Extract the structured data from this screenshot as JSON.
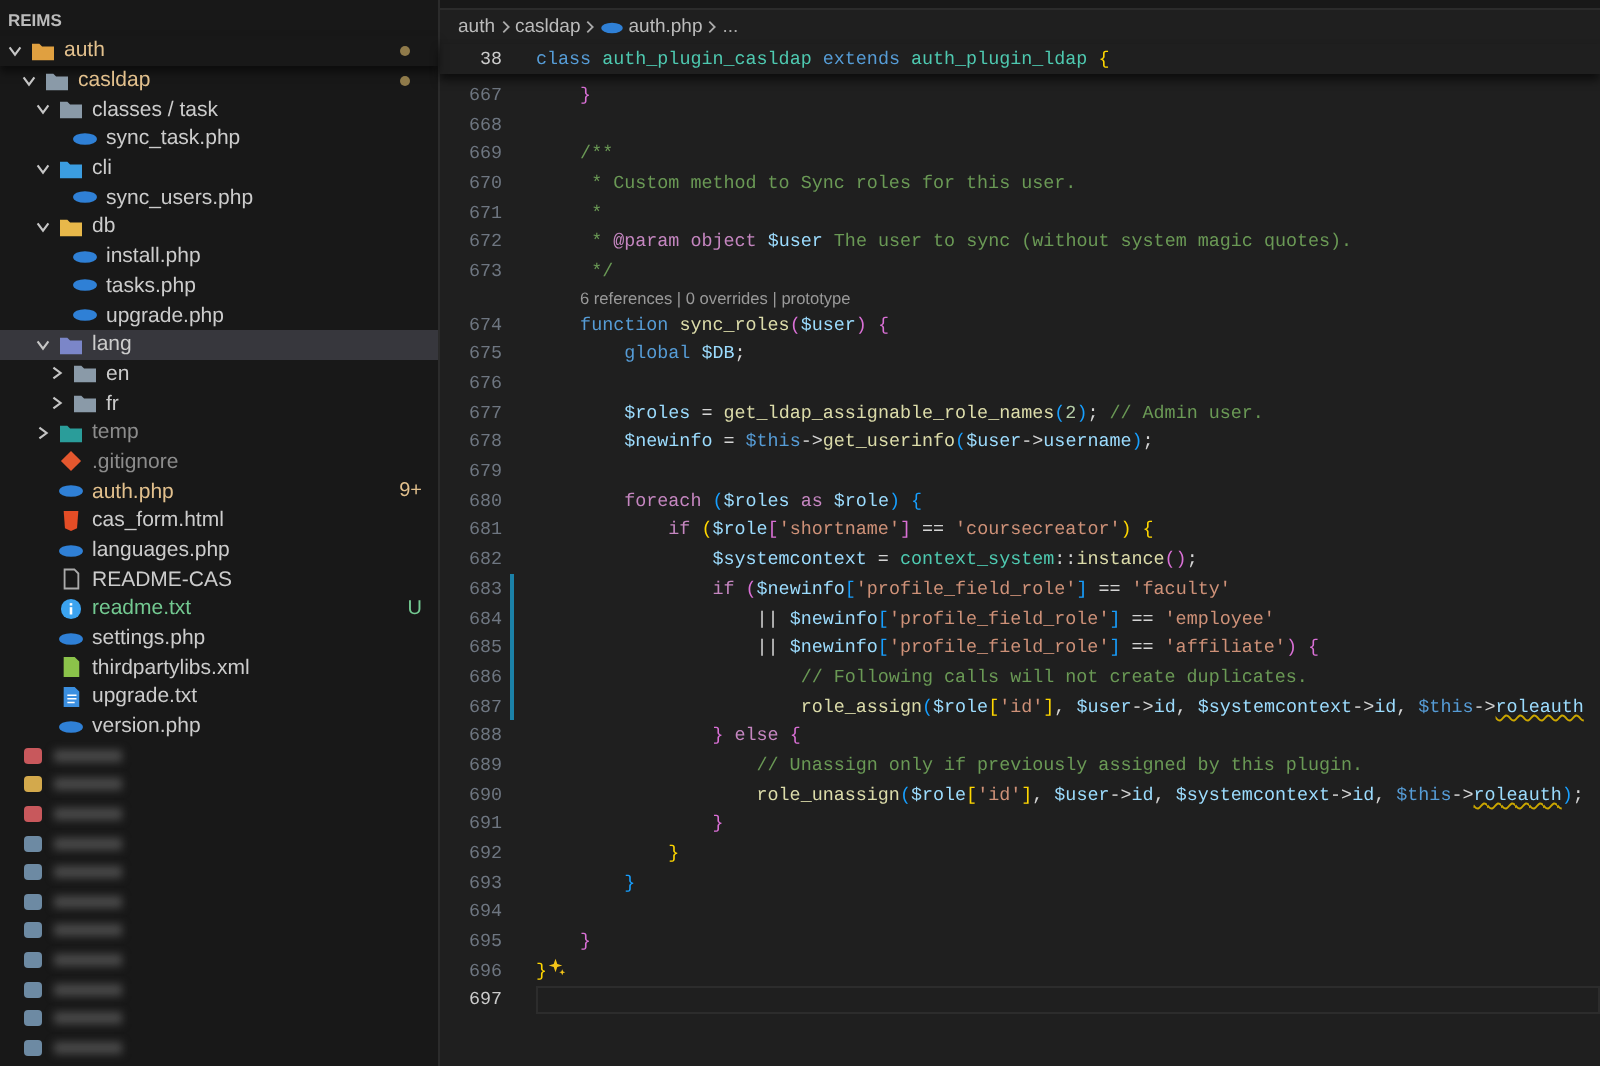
{
  "explorer": {
    "title": "REIMS",
    "items": [
      {
        "label": "auth",
        "kind": "srcfolder",
        "expanded": true,
        "selected": false,
        "color": "#e2c08d",
        "dot": true,
        "children": [
          {
            "label": "casldap",
            "kind": "folder",
            "expanded": true,
            "selected": false,
            "color": "#e2c08d",
            "dot": true,
            "children": [
              {
                "label": "classes / task",
                "kind": "folder",
                "expanded": true,
                "selected": false,
                "children": [
                  {
                    "label": "sync_task.php",
                    "kind": "php",
                    "selected": false
                  }
                ]
              },
              {
                "label": "cli",
                "kind": "clifolder",
                "expanded": true,
                "selected": false,
                "children": [
                  {
                    "label": "sync_users.php",
                    "kind": "php",
                    "selected": false
                  }
                ]
              },
              {
                "label": "db",
                "kind": "dbfolder",
                "expanded": true,
                "selected": false,
                "children": [
                  {
                    "label": "install.php",
                    "kind": "php",
                    "selected": false
                  },
                  {
                    "label": "tasks.php",
                    "kind": "php",
                    "selected": false
                  },
                  {
                    "label": "upgrade.php",
                    "kind": "php",
                    "selected": false
                  }
                ]
              },
              {
                "label": "lang",
                "kind": "langfolder",
                "expanded": true,
                "selected": true,
                "children": [
                  {
                    "label": "en",
                    "kind": "folder",
                    "expanded": false,
                    "selected": false
                  },
                  {
                    "label": "fr",
                    "kind": "folder",
                    "expanded": false,
                    "selected": false
                  }
                ]
              },
              {
                "label": "temp",
                "kind": "tempfolder",
                "expanded": false,
                "selected": false,
                "color": "#8c8c8c"
              },
              {
                "label": ".gitignore",
                "kind": "git",
                "selected": false,
                "color": "#8c8c8c"
              },
              {
                "label": "auth.php",
                "kind": "php",
                "selected": false,
                "color": "#e2c08d",
                "badge": "9+"
              },
              {
                "label": "cas_form.html",
                "kind": "html",
                "selected": false
              },
              {
                "label": "languages.php",
                "kind": "php",
                "selected": false
              },
              {
                "label": "README-CAS",
                "kind": "plain",
                "selected": false
              },
              {
                "label": "readme.txt",
                "kind": "info",
                "selected": false,
                "color": "#73c991",
                "badge": "U"
              },
              {
                "label": "settings.php",
                "kind": "php",
                "selected": false
              },
              {
                "label": "thirdpartylibs.xml",
                "kind": "xml",
                "selected": false
              },
              {
                "label": "upgrade.txt",
                "kind": "txt",
                "selected": false
              },
              {
                "label": "version.php",
                "kind": "php",
                "selected": false
              }
            ]
          }
        ]
      }
    ],
    "blurred_items": [
      {
        "color": "#c8585c"
      },
      {
        "color": "#d3a94c"
      },
      {
        "color": "#c8585c"
      },
      {
        "color": "#6d8aa3"
      },
      {
        "color": "#6d8aa3"
      },
      {
        "color": "#6d8aa3"
      },
      {
        "color": "#6d8aa3"
      },
      {
        "color": "#6d8aa3"
      },
      {
        "color": "#6d8aa3"
      },
      {
        "color": "#6d8aa3"
      },
      {
        "color": "#6d8aa3"
      }
    ]
  },
  "editor": {
    "breadcrumbs": [
      {
        "label": "auth",
        "kind": "folder"
      },
      {
        "label": "casldap",
        "kind": "folder"
      },
      {
        "label": "auth.php",
        "kind": "php"
      },
      {
        "label": "...",
        "kind": "more"
      }
    ],
    "sticky_line": {
      "number": "38",
      "tokens": [
        {
          "kind": "kw",
          "text": "class "
        },
        {
          "kind": "cls",
          "text": "auth_plugin_casldap "
        },
        {
          "kind": "kw",
          "text": "extends "
        },
        {
          "kind": "cls",
          "text": "auth_plugin_ldap "
        },
        {
          "kind": "by",
          "text": "{"
        }
      ]
    },
    "lines": [
      {
        "number": "667",
        "changed": false,
        "current": false,
        "tokens": [
          {
            "kind": "bp",
            "text": "    }"
          }
        ]
      },
      {
        "number": "668",
        "changed": false,
        "current": false
      },
      {
        "number": "669",
        "changed": false,
        "current": false,
        "tokens": [
          {
            "kind": "cmt",
            "text": "    /**"
          }
        ]
      },
      {
        "number": "670",
        "changed": false,
        "current": false,
        "tokens": [
          {
            "kind": "cmt",
            "text": "     * Custom method to Sync roles for this user."
          }
        ]
      },
      {
        "number": "671",
        "changed": false,
        "current": false,
        "tokens": [
          {
            "kind": "cmt",
            "text": "     *"
          }
        ]
      },
      {
        "number": "672",
        "changed": false,
        "current": false,
        "tokens": [
          {
            "kind": "cmt",
            "text": "     * "
          },
          {
            "kind": "tag",
            "text": "@param "
          },
          {
            "kind": "type",
            "text": "object "
          },
          {
            "kind": "var",
            "text": "$user"
          },
          {
            "kind": "cmt",
            "text": " The user to sync (without system magic quotes)."
          }
        ]
      },
      {
        "number": "673",
        "changed": false,
        "current": false,
        "tokens": [
          {
            "kind": "cmt",
            "text": "     */"
          }
        ],
        "codelens": "6 references | 0 overrides | prototype"
      },
      {
        "number": "674",
        "changed": false,
        "current": false,
        "tokens": [
          {
            "kind": "kw",
            "text": "    function "
          },
          {
            "kind": "fn",
            "text": "sync_roles"
          },
          {
            "kind": "bp",
            "text": "("
          },
          {
            "kind": "var",
            "text": "$user"
          },
          {
            "kind": "bp",
            "text": ") {"
          }
        ]
      },
      {
        "number": "675",
        "changed": false,
        "current": false,
        "tokens": [
          {
            "kind": "kw",
            "text": "        global "
          },
          {
            "kind": "var",
            "text": "$DB"
          },
          {
            "kind": "plain",
            "text": ";"
          }
        ]
      },
      {
        "number": "676",
        "changed": false,
        "current": false
      },
      {
        "number": "677",
        "changed": false,
        "current": false,
        "tokens": [
          {
            "kind": "var",
            "text": "        $roles"
          },
          {
            "kind": "plain",
            "text": " = "
          },
          {
            "kind": "fn",
            "text": "get_ldap_assignable_role_names"
          },
          {
            "kind": "bb",
            "text": "("
          },
          {
            "kind": "num",
            "text": "2"
          },
          {
            "kind": "bb",
            "text": ")"
          },
          {
            "kind": "plain",
            "text": "; "
          },
          {
            "kind": "cmt",
            "text": "// Admin user."
          }
        ]
      },
      {
        "number": "678",
        "changed": false,
        "current": false,
        "tokens": [
          {
            "kind": "var",
            "text": "        $newinfo"
          },
          {
            "kind": "plain",
            "text": " = "
          },
          {
            "kind": "kw",
            "text": "$this"
          },
          {
            "kind": "plain",
            "text": "->"
          },
          {
            "kind": "fn",
            "text": "get_userinfo"
          },
          {
            "kind": "bb",
            "text": "("
          },
          {
            "kind": "var",
            "text": "$user"
          },
          {
            "kind": "plain",
            "text": "->"
          },
          {
            "kind": "var",
            "text": "username"
          },
          {
            "kind": "bb",
            "text": ")"
          },
          {
            "kind": "plain",
            "text": ";"
          }
        ]
      },
      {
        "number": "679",
        "changed": false,
        "current": false
      },
      {
        "number": "680",
        "changed": false,
        "current": false,
        "tokens": [
          {
            "kind": "ctrl",
            "text": "        foreach "
          },
          {
            "kind": "bb",
            "text": "("
          },
          {
            "kind": "var",
            "text": "$roles "
          },
          {
            "kind": "ctrl",
            "text": "as "
          },
          {
            "kind": "var",
            "text": "$role"
          },
          {
            "kind": "bb",
            "text": ") {"
          }
        ]
      },
      {
        "number": "681",
        "changed": false,
        "current": false,
        "tokens": [
          {
            "kind": "ctrl",
            "text": "            if "
          },
          {
            "kind": "by",
            "text": "("
          },
          {
            "kind": "var",
            "text": "$role"
          },
          {
            "kind": "bp",
            "text": "["
          },
          {
            "kind": "str",
            "text": "'shortname'"
          },
          {
            "kind": "bp",
            "text": "]"
          },
          {
            "kind": "plain",
            "text": " == "
          },
          {
            "kind": "str",
            "text": "'coursecreator'"
          },
          {
            "kind": "by",
            "text": ") {"
          }
        ]
      },
      {
        "number": "682",
        "changed": false,
        "current": false,
        "tokens": [
          {
            "kind": "var",
            "text": "                $systemcontext"
          },
          {
            "kind": "plain",
            "text": " = "
          },
          {
            "kind": "cls",
            "text": "context_system"
          },
          {
            "kind": "plain",
            "text": "::"
          },
          {
            "kind": "fn",
            "text": "instance"
          },
          {
            "kind": "bp",
            "text": "()"
          },
          {
            "kind": "plain",
            "text": ";"
          }
        ]
      },
      {
        "number": "683",
        "changed": true,
        "current": false,
        "tokens": [
          {
            "kind": "ctrl",
            "text": "                if "
          },
          {
            "kind": "bp",
            "text": "("
          },
          {
            "kind": "var",
            "text": "$newinfo"
          },
          {
            "kind": "bb",
            "text": "["
          },
          {
            "kind": "str",
            "text": "'profile_field_role'"
          },
          {
            "kind": "bb",
            "text": "]"
          },
          {
            "kind": "plain",
            "text": " == "
          },
          {
            "kind": "str",
            "text": "'faculty'"
          }
        ]
      },
      {
        "number": "684",
        "changed": true,
        "current": false,
        "tokens": [
          {
            "kind": "plain",
            "text": "                    || "
          },
          {
            "kind": "var",
            "text": "$newinfo"
          },
          {
            "kind": "bb",
            "text": "["
          },
          {
            "kind": "str",
            "text": "'profile_field_role'"
          },
          {
            "kind": "bb",
            "text": "]"
          },
          {
            "kind": "plain",
            "text": " == "
          },
          {
            "kind": "str",
            "text": "'employee'"
          }
        ]
      },
      {
        "number": "685",
        "changed": true,
        "current": false,
        "tokens": [
          {
            "kind": "plain",
            "text": "                    || "
          },
          {
            "kind": "var",
            "text": "$newinfo"
          },
          {
            "kind": "bb",
            "text": "["
          },
          {
            "kind": "str",
            "text": "'profile_field_role'"
          },
          {
            "kind": "bb",
            "text": "]"
          },
          {
            "kind": "plain",
            "text": " == "
          },
          {
            "kind": "str",
            "text": "'affiliate'"
          },
          {
            "kind": "bp",
            "text": ") {"
          }
        ]
      },
      {
        "number": "686",
        "changed": true,
        "current": false,
        "tokens": [
          {
            "kind": "cmt",
            "text": "                        // Following calls will not create duplicates."
          }
        ]
      },
      {
        "number": "687",
        "changed": true,
        "current": false,
        "tokens": [
          {
            "kind": "fn",
            "text": "                        role_assign"
          },
          {
            "kind": "bb",
            "text": "("
          },
          {
            "kind": "var",
            "text": "$role"
          },
          {
            "kind": "by",
            "text": "["
          },
          {
            "kind": "str",
            "text": "'id'"
          },
          {
            "kind": "by",
            "text": "]"
          },
          {
            "kind": "plain",
            "text": ", "
          },
          {
            "kind": "var",
            "text": "$user"
          },
          {
            "kind": "plain",
            "text": "->"
          },
          {
            "kind": "var",
            "text": "id"
          },
          {
            "kind": "plain",
            "text": ", "
          },
          {
            "kind": "var",
            "text": "$systemcontext"
          },
          {
            "kind": "plain",
            "text": "->"
          },
          {
            "kind": "var",
            "text": "id"
          },
          {
            "kind": "plain",
            "text": ", "
          },
          {
            "kind": "kw",
            "text": "$this"
          },
          {
            "kind": "plain",
            "text": "->"
          },
          {
            "kind": "warn",
            "text": "roleauth"
          }
        ]
      },
      {
        "number": "688",
        "changed": false,
        "current": false,
        "tokens": [
          {
            "kind": "bp",
            "text": "                } "
          },
          {
            "kind": "ctrl",
            "text": "else "
          },
          {
            "kind": "bp",
            "text": "{"
          }
        ]
      },
      {
        "number": "689",
        "changed": false,
        "current": false,
        "tokens": [
          {
            "kind": "cmt",
            "text": "                    // Unassign only if previously assigned by this plugin."
          }
        ]
      },
      {
        "number": "690",
        "changed": false,
        "current": false,
        "tokens": [
          {
            "kind": "fn",
            "text": "                    role_unassign"
          },
          {
            "kind": "bb",
            "text": "("
          },
          {
            "kind": "var",
            "text": "$role"
          },
          {
            "kind": "by",
            "text": "["
          },
          {
            "kind": "str",
            "text": "'id'"
          },
          {
            "kind": "by",
            "text": "]"
          },
          {
            "kind": "plain",
            "text": ", "
          },
          {
            "kind": "var",
            "text": "$user"
          },
          {
            "kind": "plain",
            "text": "->"
          },
          {
            "kind": "var",
            "text": "id"
          },
          {
            "kind": "plain",
            "text": ", "
          },
          {
            "kind": "var",
            "text": "$systemcontext"
          },
          {
            "kind": "plain",
            "text": "->"
          },
          {
            "kind": "var",
            "text": "id"
          },
          {
            "kind": "plain",
            "text": ", "
          },
          {
            "kind": "kw",
            "text": "$this"
          },
          {
            "kind": "plain",
            "text": "->"
          },
          {
            "kind": "warn",
            "text": "roleauth"
          },
          {
            "kind": "bb",
            "text": ")"
          },
          {
            "kind": "plain",
            "text": ";"
          }
        ]
      },
      {
        "number": "691",
        "changed": false,
        "current": false,
        "tokens": [
          {
            "kind": "bp",
            "text": "                }"
          }
        ]
      },
      {
        "number": "692",
        "changed": false,
        "current": false,
        "tokens": [
          {
            "kind": "by",
            "text": "            }"
          }
        ]
      },
      {
        "number": "693",
        "changed": false,
        "current": false,
        "tokens": [
          {
            "kind": "bb",
            "text": "        }"
          }
        ]
      },
      {
        "number": "694",
        "changed": false,
        "current": false
      },
      {
        "number": "695",
        "changed": false,
        "current": false,
        "tokens": [
          {
            "kind": "bp",
            "text": "    }"
          }
        ]
      },
      {
        "number": "696",
        "changed": false,
        "current": false,
        "sparkle": true,
        "tokens": [
          {
            "kind": "by",
            "text": "}"
          }
        ]
      },
      {
        "number": "697",
        "changed": false,
        "current": true
      }
    ]
  }
}
